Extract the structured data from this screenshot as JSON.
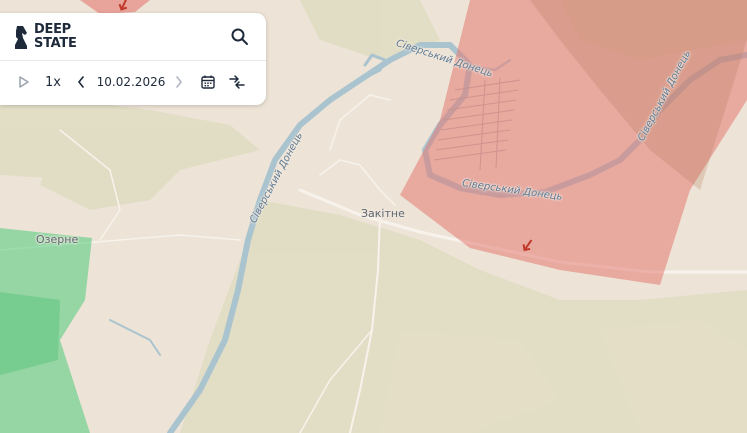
{
  "brand": {
    "line1": "DEEP",
    "line2": "STATE"
  },
  "toolbar": {
    "speed_label": "1x",
    "date": "10.02.2026"
  },
  "map": {
    "places": {
      "zakitne": "Закітне",
      "ozerne": "Озерне"
    },
    "rivers": {
      "label_north": "Сіверський Донець",
      "label_west": "Сіверський Донець",
      "label_bend": "Сіверський Донець",
      "label_east": "Сіверський Донець"
    },
    "colors": {
      "occupied": "#e47a72",
      "liberated": "#4fca7c",
      "land": "#ede3d6",
      "vegetation": "#dcdcc0",
      "river": "#a9c4cf",
      "frontline_marker": "#c0392b"
    }
  }
}
